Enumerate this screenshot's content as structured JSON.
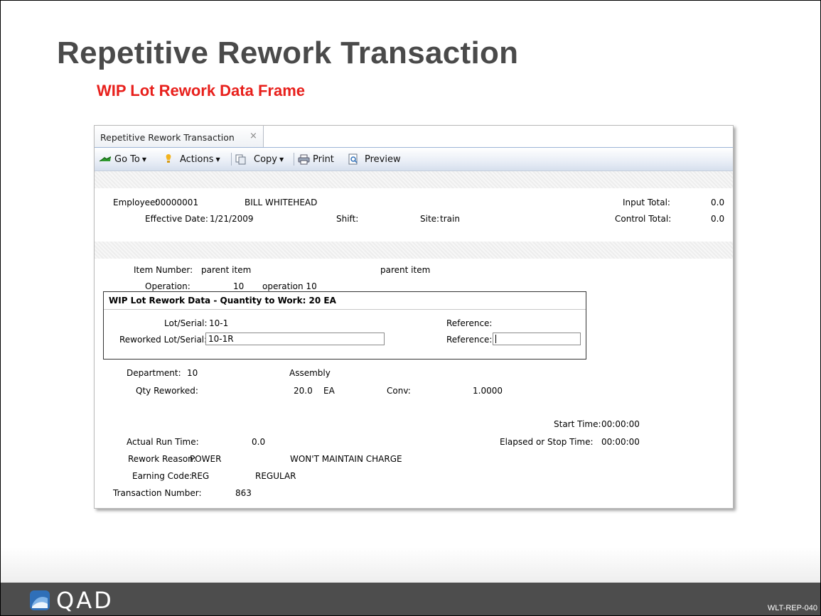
{
  "slide": {
    "title": "Repetitive Rework Transaction",
    "subtitle": "WIP Lot Rework Data Frame",
    "footer_logo": "QAD",
    "doc_code": "WLT-REP-040"
  },
  "window": {
    "tab_label": "Repetitive Rework Transaction",
    "tab_close": "×",
    "toolbar": {
      "goto": "Go To",
      "actions": "Actions",
      "copy": "Copy",
      "print": "Print",
      "preview": "Preview",
      "caret": "▼"
    }
  },
  "header": {
    "employee_label": "Employee:",
    "employee_id": "00000001",
    "employee_name": "BILL WHITEHEAD",
    "input_total_label": "Input Total:",
    "input_total": "0.0",
    "effective_date_label": "Effective Date:",
    "effective_date": "1/21/2009",
    "shift_label": "Shift:",
    "site_label": "Site:",
    "site": "train",
    "control_total_label": "Control Total:",
    "control_total": "0.0"
  },
  "item": {
    "item_number_label": "Item Number:",
    "item_number": "parent item",
    "item_desc": "parent item",
    "operation_label": "Operation:",
    "operation": "10",
    "operation_desc": "operation 10"
  },
  "rework_frame": {
    "title": "WIP Lot Rework Data - Quantity to Work: 20 EA",
    "lot_serial_label": "Lot/Serial:",
    "lot_serial": "10-1",
    "reference_label": "Reference:",
    "reworked_lot_label": "Reworked Lot/Serial:",
    "reworked_lot_value": "10-1R",
    "reference2_label": "Reference:",
    "reference2_value": ""
  },
  "details": {
    "department_label": "Department:",
    "department": "10",
    "department_desc": "Assembly",
    "qty_reworked_label": "Qty Reworked:",
    "qty_reworked": "20.0",
    "qty_um": "EA",
    "conv_label": "Conv:",
    "conv": "1.0000",
    "start_time_label": "Start Time:",
    "start_time": "00:00:00",
    "actual_run_time_label": "Actual Run Time:",
    "actual_run_time": "0.0",
    "elapsed_label": "Elapsed or Stop Time:",
    "elapsed_time": "00:00:00",
    "rework_reason_label": "Rework Reason:",
    "rework_reason": "POWER",
    "rework_reason_desc": "WON'T MAINTAIN CHARGE",
    "earning_code_label": "Earning Code:",
    "earning_code": "REG",
    "earning_code_desc": "REGULAR",
    "transaction_number_label": "Transaction Number:",
    "transaction_number": "863"
  },
  "colors": {
    "title": "#4a4a4a",
    "subtitle": "#e8201c",
    "footer": "#4d4d4d",
    "logo_blue": "#2f6fb8"
  },
  "icons": [
    "goto-arrow-icon",
    "actions-bulb-icon",
    "copy-icon",
    "print-icon",
    "preview-icon",
    "close-icon",
    "qad-logo-icon"
  ]
}
